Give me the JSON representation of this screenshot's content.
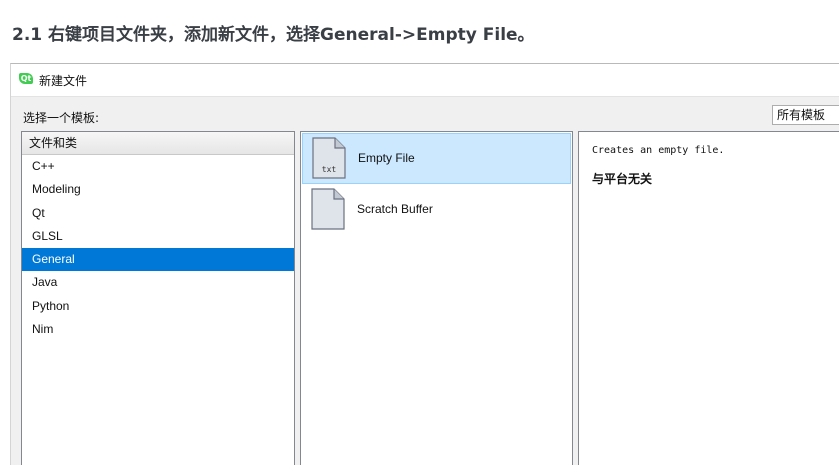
{
  "heading": "2.1 右键项目文件夹，添加新文件，选择General->Empty File。",
  "dialog": {
    "title": "新建文件",
    "logo_text": "Qt",
    "choose_template_label": "选择一个模板:",
    "filter_value": "所有模板",
    "categories": {
      "header": "文件和类",
      "items": [
        "C++",
        "Modeling",
        "Qt",
        "GLSL",
        "General",
        "Java",
        "Python",
        "Nim"
      ],
      "selected": "General"
    },
    "templates": [
      {
        "label": "Empty File",
        "icon": "txt-file-icon",
        "icon_text": "txt",
        "selected": true
      },
      {
        "label": "Scratch Buffer",
        "icon": "blank-file-icon",
        "icon_text": "",
        "selected": false
      }
    ],
    "description": {
      "text": "Creates an empty file.",
      "platform": "与平台无关"
    }
  },
  "colors": {
    "selection_blue": "#0078d7",
    "template_selection": "#cce8ff",
    "qt_green": "#41cd52"
  }
}
